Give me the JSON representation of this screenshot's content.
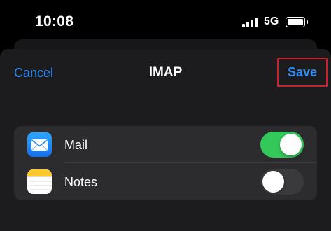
{
  "status_bar": {
    "time": "10:08",
    "network": "5G",
    "icons": [
      "signal-bars-icon",
      "battery-icon"
    ]
  },
  "nav": {
    "cancel_label": "Cancel",
    "title": "IMAP",
    "save_label": "Save"
  },
  "settings": [
    {
      "label": "Mail",
      "icon": "mail-icon",
      "enabled": true
    },
    {
      "label": "Notes",
      "icon": "notes-icon",
      "enabled": false
    }
  ],
  "colors": {
    "accent": "#2f8df7",
    "toggle_on": "#34c759",
    "toggle_off": "#3a3a3c",
    "highlight_border": "#c8232f"
  }
}
